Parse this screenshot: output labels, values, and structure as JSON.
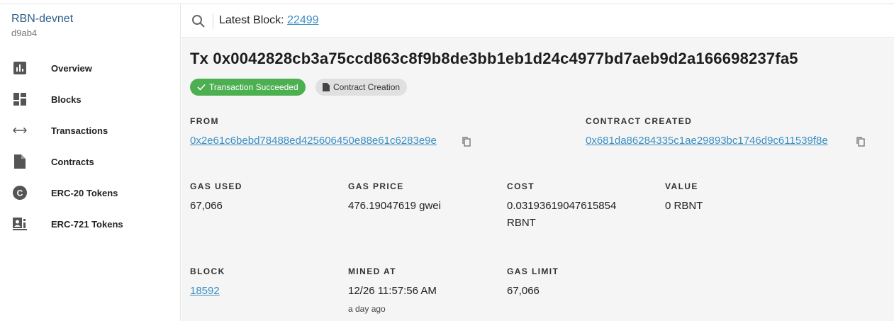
{
  "brand": {
    "name": "RBN-devnet",
    "hash": "d9ab4"
  },
  "sidebar": {
    "items": [
      {
        "label": "Overview",
        "icon": "bar-chart-icon"
      },
      {
        "label": "Blocks",
        "icon": "dashboard-icon"
      },
      {
        "label": "Transactions",
        "icon": "swap-horiz-icon"
      },
      {
        "label": "Contracts",
        "icon": "document-icon"
      },
      {
        "label": "ERC-20 Tokens",
        "icon": "coin-c-icon"
      },
      {
        "label": "ERC-721 Tokens",
        "icon": "nft-icon"
      }
    ]
  },
  "topbar": {
    "latest_label": "Latest Block:",
    "latest_block": "22499"
  },
  "tx": {
    "title": "Tx 0x0042828cb3a75ccd863c8f9b8de3bb1eb1d24c4977bd7aeb9d2a166698237fa5",
    "status_chip": "Transaction Succeeded",
    "type_chip": "Contract Creation",
    "from_label": "FROM",
    "from_value": "0x2e61c6bebd78488ed425606450e88e61c6283e9e",
    "contract_label": "CONTRACT CREATED",
    "contract_value": "0x681da86284335c1ae29893bc1746d9c611539f8e",
    "gas_used_label": "GAS USED",
    "gas_used_value": "67,066",
    "gas_price_label": "GAS PRICE",
    "gas_price_value": "476.19047619 gwei",
    "cost_label": "COST",
    "cost_value_line1": "0.03193619047615854",
    "cost_value_line2": "RBNT",
    "value_label": "VALUE",
    "value_value": "0 RBNT",
    "block_label": "BLOCK",
    "block_value": "18592",
    "mined_label": "MINED AT",
    "mined_value": "12/26 11:57:56 AM",
    "mined_relative": "a day ago",
    "gas_limit_label": "GAS LIMIT",
    "gas_limit_value": "67,066"
  },
  "colors": {
    "accent": "#3b8fc4",
    "success": "#4caf50",
    "brand": "#2f5d8a"
  }
}
